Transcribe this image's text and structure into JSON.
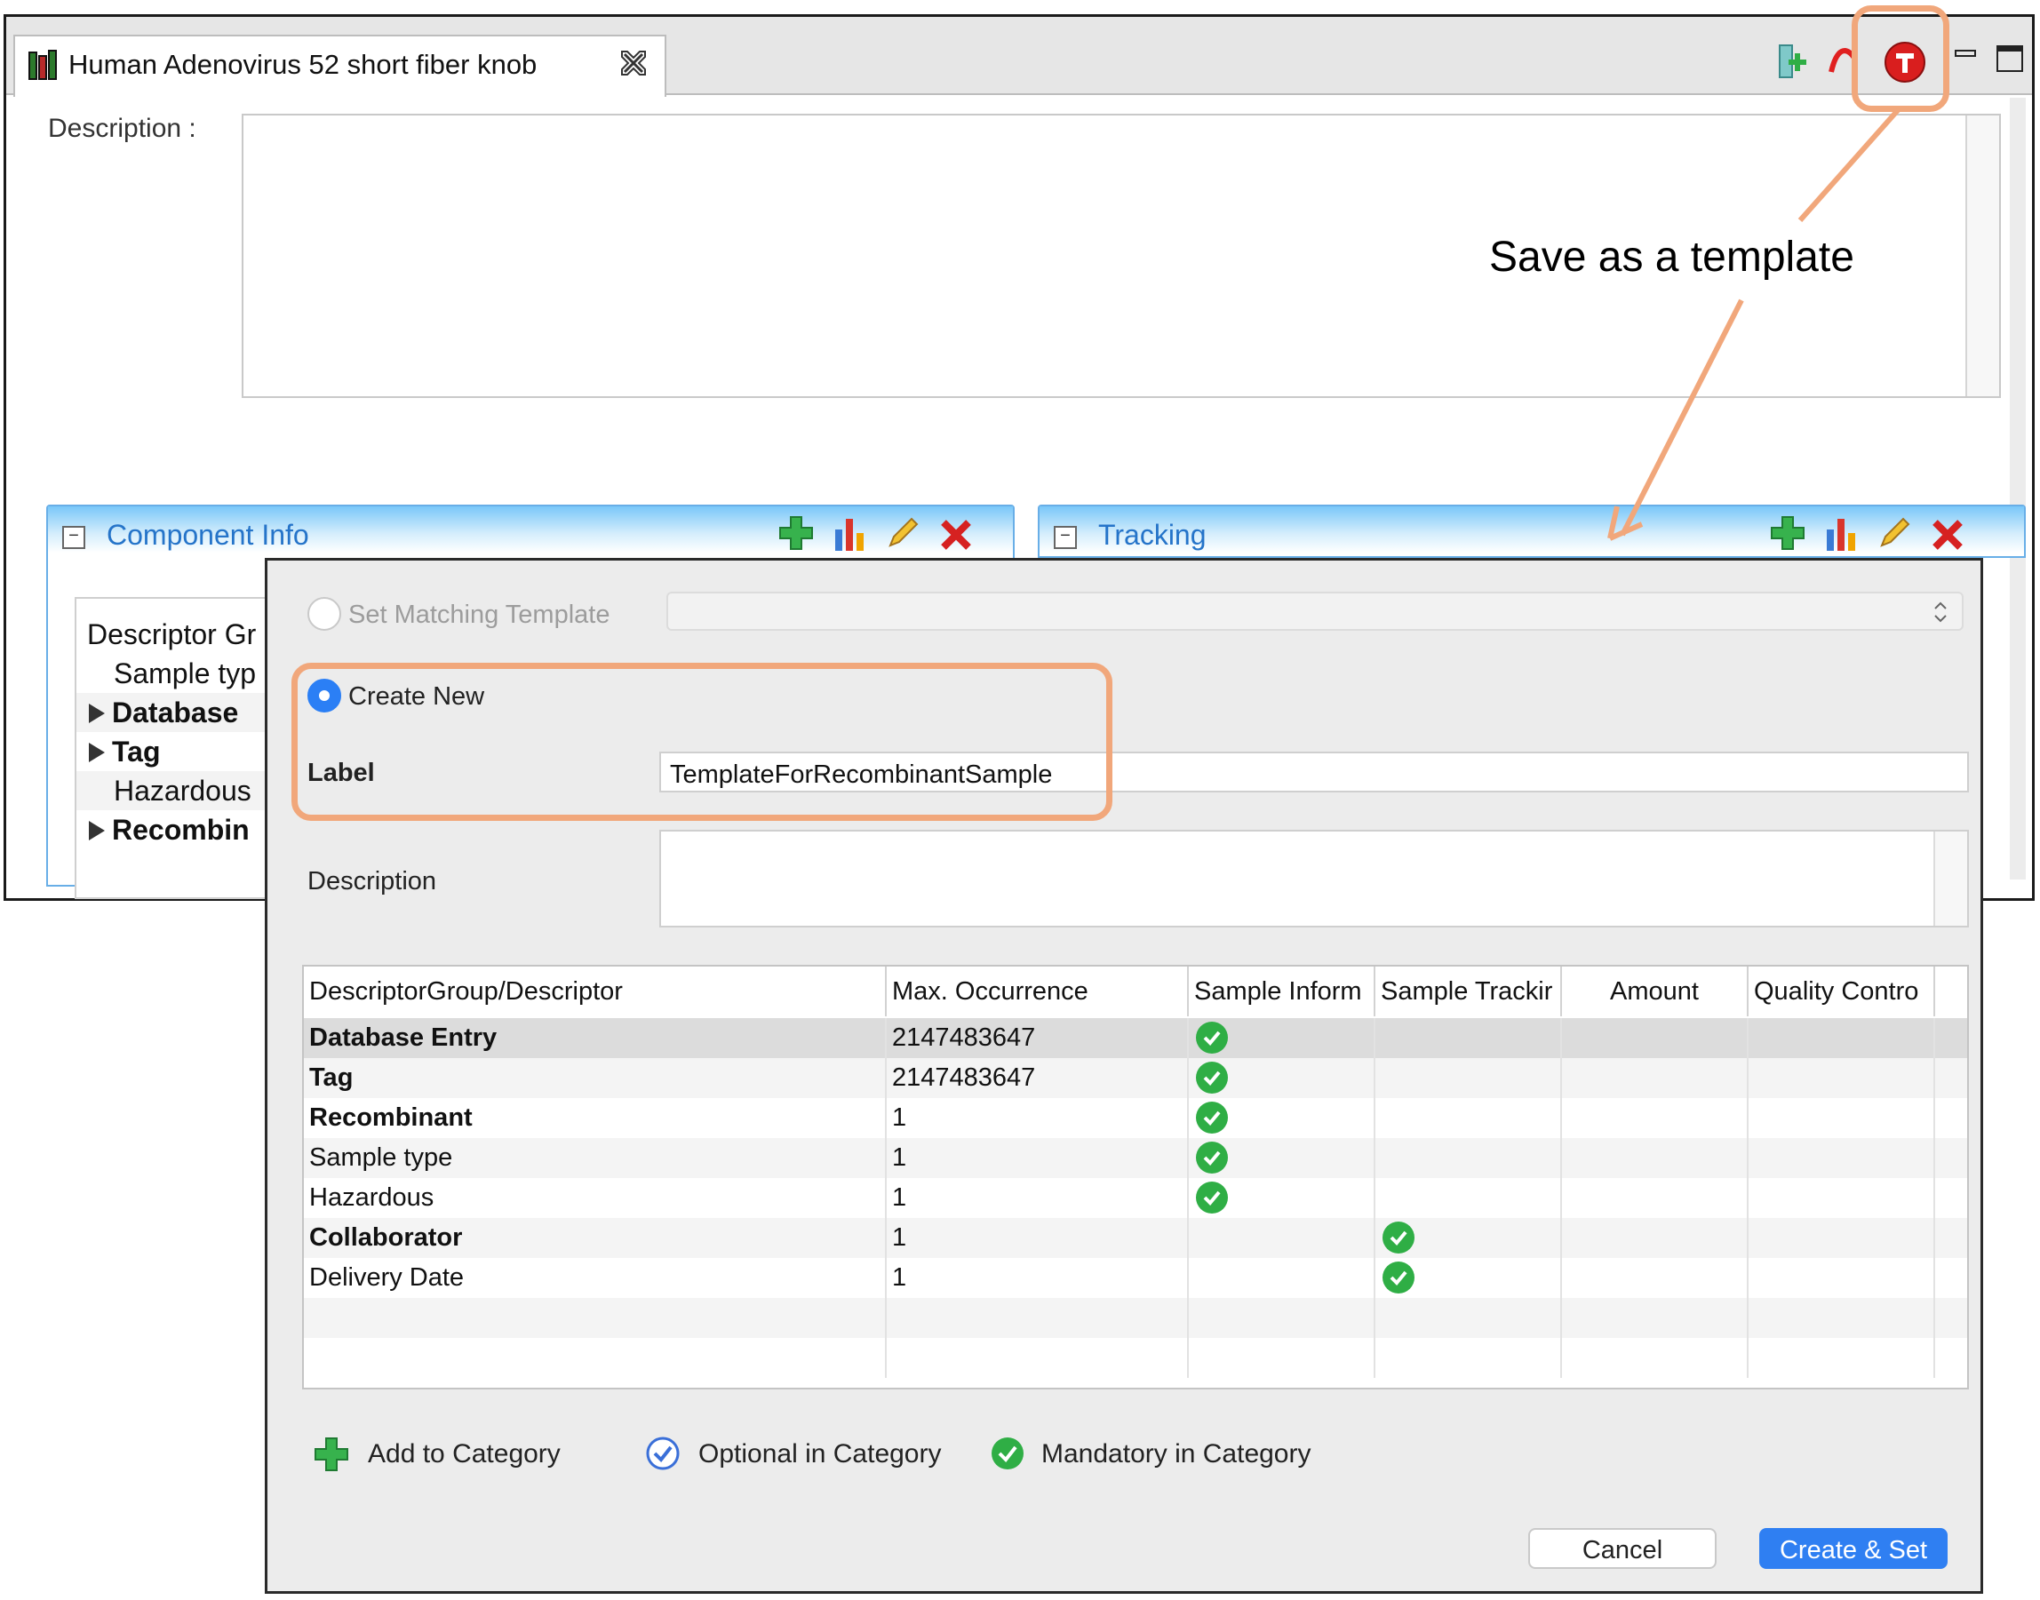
{
  "editor": {
    "tab_title": "Human Adenovirus 52 short fiber knob",
    "description_label": "Description :",
    "component_panel_title": "Component Info",
    "tracking_panel_title": "Tracking",
    "tree": {
      "header": "Descriptor Gr",
      "rows": [
        {
          "label": "Sample typ",
          "bold": false,
          "expandable": false
        },
        {
          "label": "Database",
          "bold": true,
          "expandable": true
        },
        {
          "label": "Tag",
          "bold": true,
          "expandable": true
        },
        {
          "label": "Hazardous",
          "bold": false,
          "expandable": false
        },
        {
          "label": "Recombin",
          "bold": true,
          "expandable": true
        }
      ]
    }
  },
  "annotation": {
    "callout_text": "Save as a template",
    "highlight_color": "#f1a77b"
  },
  "dialog": {
    "set_matching_label": "Set Matching Template",
    "create_new_label": "Create New",
    "label_field_label": "Label",
    "label_value": "TemplateForRecombinantSample",
    "description_label": "Description",
    "grid": {
      "columns": [
        "DescriptorGroup/Descriptor",
        "Max. Occurrence",
        "Sample Inform",
        "Sample Trackir",
        "Amount",
        "Quality Contro"
      ],
      "rows": [
        {
          "descriptor": "Database Entry",
          "max": "2147483647",
          "bold": true,
          "check_col": 2
        },
        {
          "descriptor": "Tag",
          "max": "2147483647",
          "bold": true,
          "check_col": 2
        },
        {
          "descriptor": "Recombinant",
          "max": "1",
          "bold": true,
          "check_col": 2
        },
        {
          "descriptor": "Sample type",
          "max": "1",
          "bold": false,
          "check_col": 2
        },
        {
          "descriptor": "Hazardous",
          "max": "1",
          "bold": false,
          "check_col": 2
        },
        {
          "descriptor": "Collaborator",
          "max": "1",
          "bold": true,
          "check_col": 3
        },
        {
          "descriptor": "Delivery Date",
          "max": "1",
          "bold": false,
          "check_col": 3
        }
      ]
    },
    "legend": {
      "add": "Add to Category",
      "optional": "Optional in Category",
      "mandatory": "Mandatory in Category"
    },
    "cancel_label": "Cancel",
    "create_label": "Create & Set",
    "accent_color": "#2f7ff2",
    "check_color": "#2fae45"
  }
}
